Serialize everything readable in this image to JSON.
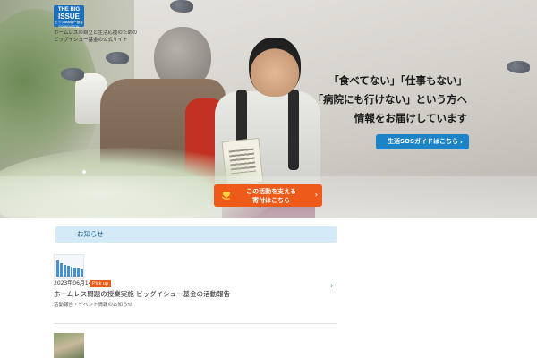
{
  "logo": {
    "line1": "THE BIG",
    "line2": "ISSUE",
    "line3": "JAPAN FOUNDATION",
    "sub": "ビッグイシュー基金"
  },
  "logo_caption": {
    "line1": "ホームレスの自立と生活応援のための",
    "line2": "ビッグイシュー基金の公式サイト"
  },
  "hero": {
    "headline_1": "「食べてない」「仕事もない」",
    "headline_2": "「病院にも行けない」という方へ",
    "headline_3": "情報をお届けしています",
    "sos_button": "生活SOSガイドはこちら",
    "donate_line1": "この活動を支える",
    "donate_line2": "寄付はこちら"
  },
  "news": {
    "header": "お知らせ",
    "items": [
      {
        "date": "2023年06月14日",
        "badge": "Pick up",
        "title": "ホームレス問題の授業実施 ビッグイシュー基金の活動報告",
        "excerpt": "活動報告・イベント情報のお知らせ"
      }
    ]
  },
  "icons": {
    "donate": "heart-hand-icon",
    "chevron": "chevron-right-icon"
  },
  "colors": {
    "brand_blue": "#1d6fb8",
    "sos_blue": "#1c84c6",
    "donate_orange": "#ee5a1a",
    "news_header_bg": "#d4eaf7"
  }
}
